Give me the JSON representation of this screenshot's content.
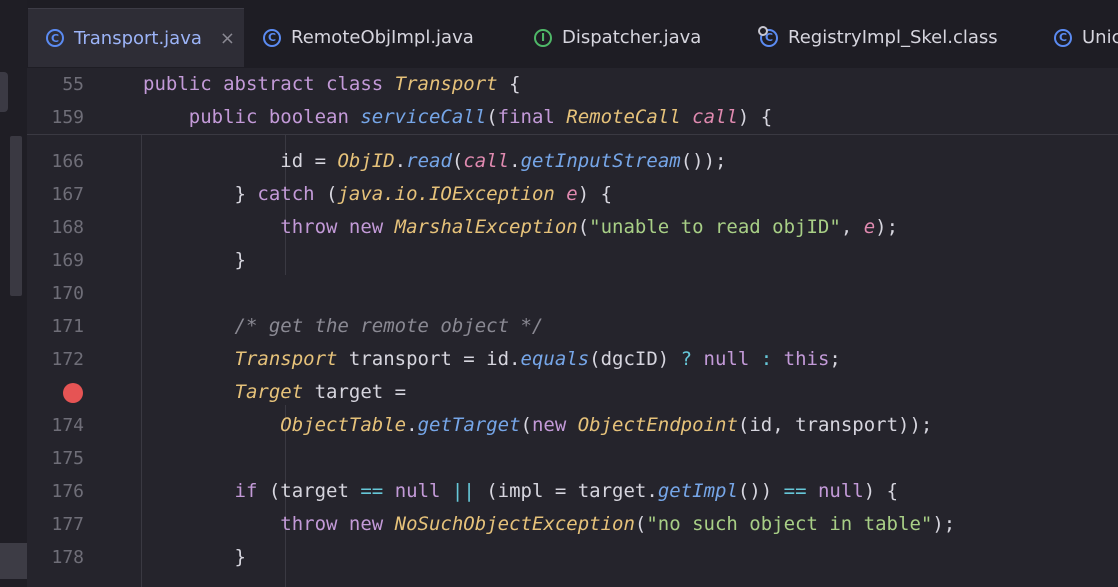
{
  "tabs": [
    {
      "label": "Transport.java",
      "icon": "class-icon",
      "active": true,
      "close": "×"
    },
    {
      "label": "RemoteObjImpl.java",
      "icon": "class-icon"
    },
    {
      "label": "Dispatcher.java",
      "icon": "interface-icon"
    },
    {
      "label": "RegistryImpl_Skel.class",
      "icon": "compiled-class-icon"
    },
    {
      "label": "Unic",
      "icon": "class-icon"
    }
  ],
  "tab_icon_letters": {
    "class": "C",
    "interface": "I"
  },
  "sticky_lines": [
    {
      "num": "55",
      "tokens": [
        [
          "kw",
          "public abstract class "
        ],
        [
          "ty",
          "Transport"
        ],
        [
          "pl",
          " {"
        ]
      ]
    },
    {
      "num": "159",
      "tokens": [
        [
          "kw",
          "    public boolean "
        ],
        [
          "fn",
          "serviceCall"
        ],
        [
          "pl",
          "("
        ],
        [
          "kw",
          "final "
        ],
        [
          "ty",
          "RemoteCall "
        ],
        [
          "pa",
          "call"
        ],
        [
          "pl",
          ") {"
        ]
      ]
    }
  ],
  "lines": [
    {
      "num": "166",
      "tokens": [
        [
          "pl",
          "            id = "
        ],
        [
          "ty",
          "ObjID"
        ],
        [
          "pl",
          "."
        ],
        [
          "fn",
          "read"
        ],
        [
          "pl",
          "("
        ],
        [
          "pa",
          "call"
        ],
        [
          "pl",
          "."
        ],
        [
          "fn",
          "getInputStream"
        ],
        [
          "pl",
          "());"
        ]
      ]
    },
    {
      "num": "167",
      "tokens": [
        [
          "pl",
          "        } "
        ],
        [
          "kw",
          "catch "
        ],
        [
          "pl",
          "("
        ],
        [
          "ty",
          "java.io.IOException "
        ],
        [
          "pa",
          "e"
        ],
        [
          "pl",
          ") {"
        ]
      ]
    },
    {
      "num": "168",
      "tokens": [
        [
          "kw",
          "            throw new "
        ],
        [
          "ty",
          "MarshalException"
        ],
        [
          "pl",
          "("
        ],
        [
          "st",
          "\"unable to read objID\""
        ],
        [
          "pl",
          ", "
        ],
        [
          "pa",
          "e"
        ],
        [
          "pl",
          ");"
        ]
      ]
    },
    {
      "num": "169",
      "tokens": [
        [
          "pl",
          "        }"
        ]
      ]
    },
    {
      "num": "170",
      "tokens": []
    },
    {
      "num": "171",
      "tokens": [
        [
          "cm",
          "        /* get the remote object */"
        ]
      ]
    },
    {
      "num": "172",
      "tokens": [
        [
          "ty",
          "        Transport "
        ],
        [
          "pl",
          "transport = id."
        ],
        [
          "fn",
          "equals"
        ],
        [
          "pl",
          "(dgcID) "
        ],
        [
          "op",
          "? "
        ],
        [
          "kw",
          "null "
        ],
        [
          "op",
          ": "
        ],
        [
          "kw",
          "this"
        ],
        [
          "pl",
          ";"
        ]
      ]
    },
    {
      "num": "",
      "breakpoint": true,
      "tokens": [
        [
          "ty",
          "        Target "
        ],
        [
          "pl",
          "target ="
        ]
      ]
    },
    {
      "num": "174",
      "tokens": [
        [
          "ty",
          "            ObjectTable"
        ],
        [
          "pl",
          "."
        ],
        [
          "fn",
          "getTarget"
        ],
        [
          "pl",
          "("
        ],
        [
          "kw",
          "new "
        ],
        [
          "ty",
          "ObjectEndpoint"
        ],
        [
          "pl",
          "(id, transport));"
        ]
      ]
    },
    {
      "num": "175",
      "tokens": []
    },
    {
      "num": "176",
      "tokens": [
        [
          "kw",
          "        if "
        ],
        [
          "pl",
          "(target "
        ],
        [
          "op",
          "== "
        ],
        [
          "kw",
          "null "
        ],
        [
          "op",
          "|| "
        ],
        [
          "pl",
          "(impl = target."
        ],
        [
          "fn",
          "getImpl"
        ],
        [
          "pl",
          "()) "
        ],
        [
          "op",
          "== "
        ],
        [
          "kw",
          "null"
        ],
        [
          "pl",
          ") {"
        ]
      ]
    },
    {
      "num": "177",
      "tokens": [
        [
          "kw",
          "            throw new "
        ],
        [
          "ty",
          "NoSuchObjectException"
        ],
        [
          "pl",
          "("
        ],
        [
          "st",
          "\"no such object in table\""
        ],
        [
          "pl",
          ");"
        ]
      ]
    },
    {
      "num": "178",
      "tokens": [
        [
          "pl",
          "        }"
        ]
      ]
    }
  ],
  "colors": {
    "background": "#25242c",
    "keyword": "#c39ad8",
    "type": "#e6c27a",
    "method": "#76a6e8",
    "param": "#e08ab0",
    "string": "#a8cf86",
    "comment": "#8a8993",
    "breakpoint": "#e65454"
  }
}
